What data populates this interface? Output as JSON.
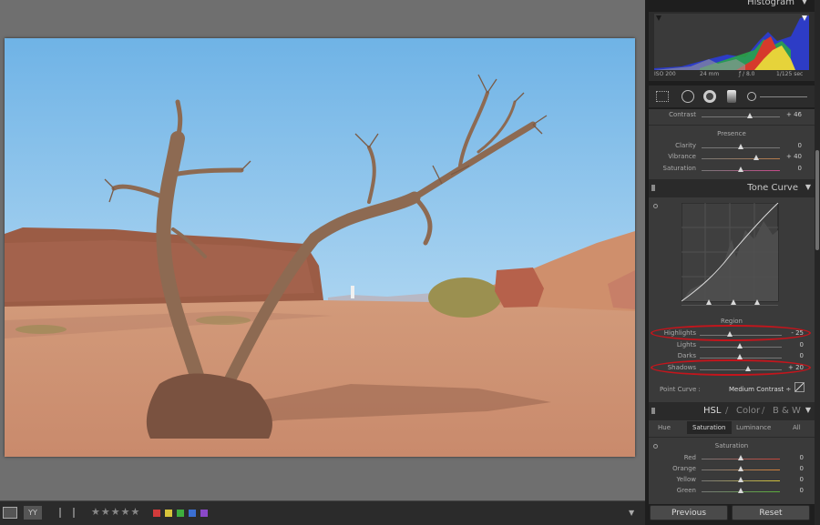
{
  "histogram": {
    "title": "Histogram",
    "iso": "ISO 200",
    "focal": "24 mm",
    "aperture": "ƒ / 8.0",
    "shutter": "1/125 sec"
  },
  "basic": {
    "contrast_label": "Contrast",
    "contrast_value": "+ 46",
    "presence_title": "Presence",
    "sliders": [
      {
        "label": "Clarity",
        "value": "0",
        "level": 0.5
      },
      {
        "label": "Vibrance",
        "value": "+ 40",
        "level": 0.7
      },
      {
        "label": "Saturation",
        "value": "0",
        "level": 0.5
      }
    ]
  },
  "tone_curve": {
    "title": "Tone Curve",
    "region_title": "Region",
    "sliders": [
      {
        "label": "Highlights",
        "value": "- 25",
        "level": 0.375
      },
      {
        "label": "Lights",
        "value": "0",
        "level": 0.5
      },
      {
        "label": "Darks",
        "value": "0",
        "level": 0.5
      },
      {
        "label": "Shadows",
        "value": "+ 20",
        "level": 0.6
      }
    ],
    "point_curve_label": "Point Curve :",
    "point_curve_value": "Medium Contrast ÷"
  },
  "hsl": {
    "title_hsl": "HSL",
    "title_sep": "/",
    "title_color": "Color",
    "title_bw": "B & W",
    "tabs": [
      "Hue",
      "Saturation",
      "Luminance",
      "All"
    ],
    "active_tab": "Saturation",
    "section_title": "Saturation",
    "sliders": [
      {
        "label": "Red",
        "value": "0",
        "level": 0.5
      },
      {
        "label": "Orange",
        "value": "0",
        "level": 0.5
      },
      {
        "label": "Yellow",
        "value": "0",
        "level": 0.5
      },
      {
        "label": "Green",
        "value": "0",
        "level": 0.5
      }
    ]
  },
  "buttons": {
    "previous": "Previous",
    "reset": "Reset"
  },
  "toolbar": {
    "rating_stars": "★★★★★",
    "color_labels": [
      "#d23b3b",
      "#d8c43b",
      "#3eae3e",
      "#3b6fd2",
      "#8a48c8"
    ],
    "view_mode": "YY"
  },
  "colors": {
    "highlight_ring": "#c4151c",
    "panel_bg": "#3a3a3a"
  }
}
